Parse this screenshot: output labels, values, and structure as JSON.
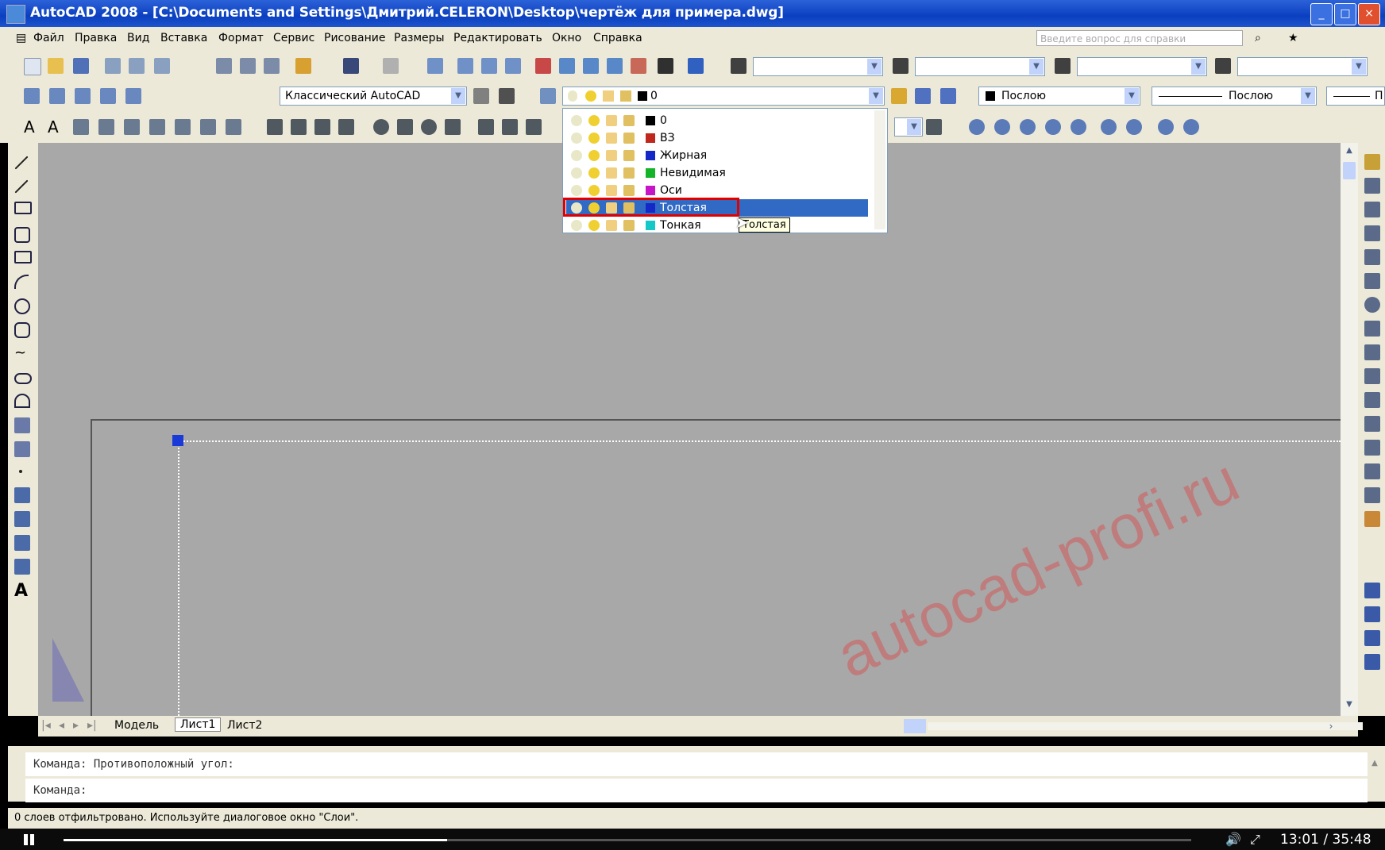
{
  "window": {
    "title": "AutoCAD 2008 - [C:\\Documents and Settings\\Дмитрий.CELERON\\Desktop\\чертёж для примера.dwg]"
  },
  "menu": [
    "Файл",
    "Правка",
    "Вид",
    "Вставка",
    "Формат",
    "Сервис",
    "Рисование",
    "Размеры",
    "Редактировать",
    "Окно",
    "Справка"
  ],
  "help": {
    "placeholder": "Введите вопрос для справки"
  },
  "toolbar2": {
    "workspace": "Классический AutoCAD",
    "layer": "0",
    "color": "Послою",
    "linetype": "Послою",
    "lineweight": "П"
  },
  "layer_dropdown": {
    "items": [
      {
        "name": "0",
        "color": "#000000"
      },
      {
        "name": "ВЗ",
        "color": "#c0281e"
      },
      {
        "name": "Жирная",
        "color": "#1428c8"
      },
      {
        "name": "Невидимая",
        "color": "#14b428"
      },
      {
        "name": "Оси",
        "color": "#c814c8"
      },
      {
        "name": "Толстая",
        "color": "#1428c8"
      },
      {
        "name": "Тонкая",
        "color": "#14c8c8"
      }
    ],
    "selected": "Толстая",
    "tooltip": "Толстая"
  },
  "tabs": [
    "Модель",
    "Лист1",
    "Лист2"
  ],
  "command": {
    "line1": "Команда: Противоположный угол:",
    "line2": "Команда:"
  },
  "status": {
    "text": "0 слоев отфильтровано. Используйте диалоговое окно \"Слои\"."
  },
  "player": {
    "time": "13:01 / 35:48",
    "progress": 0.34
  },
  "watermark": "autocad-profi.ru",
  "colors": {
    "highlight": "#316ac5",
    "red_box": "#e00000",
    "canvas": "#a8a8a8"
  }
}
